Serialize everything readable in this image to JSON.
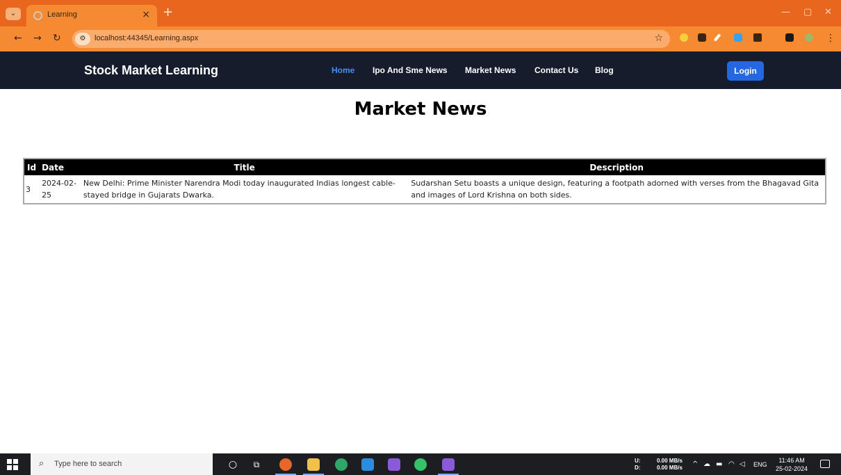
{
  "browser": {
    "tab_title": "Learning",
    "tab_close": "×",
    "new_tab": "+",
    "url": "localhost:44345/Learning.aspx",
    "controls": {
      "minimize": "—",
      "maximize": "▢",
      "close": "✕"
    }
  },
  "site": {
    "brand": "Stock Market Learning",
    "nav": [
      {
        "label": "Home",
        "active": true
      },
      {
        "label": "Ipo And Sme News",
        "active": false
      },
      {
        "label": "Market News",
        "active": false
      },
      {
        "label": "Contact Us",
        "active": false
      },
      {
        "label": "Blog",
        "active": false
      }
    ],
    "login_label": "Login"
  },
  "main": {
    "heading": "Market News",
    "table": {
      "columns": [
        "Id",
        "Date",
        "Title",
        "Description"
      ],
      "rows": [
        {
          "id": "3",
          "date": "2024-02-25",
          "title": "New Delhi: Prime Minister Narendra Modi today inaugurated Indias longest cable-stayed bridge in Gujarats Dwarka.",
          "description": "Sudarshan Setu boasts a unique design, featuring a footpath adorned with verses from the Bhagavad Gita and images of Lord Krishna on both sides."
        }
      ]
    }
  },
  "taskbar": {
    "search_placeholder": "Type here to search",
    "net_up_label": "U:",
    "net_down_label": "D:",
    "net_up": "0.00 MB/s",
    "net_down": "0.00 MB/s",
    "language": "ENG",
    "time": "11:46 AM",
    "date": "25-02-2024"
  },
  "colors": {
    "chrome_frame": "#e8661e",
    "navbar_bg": "#151c2b",
    "nav_active": "#4a8ef0",
    "login_bg": "#2467e0",
    "table_header_bg": "#000000"
  }
}
